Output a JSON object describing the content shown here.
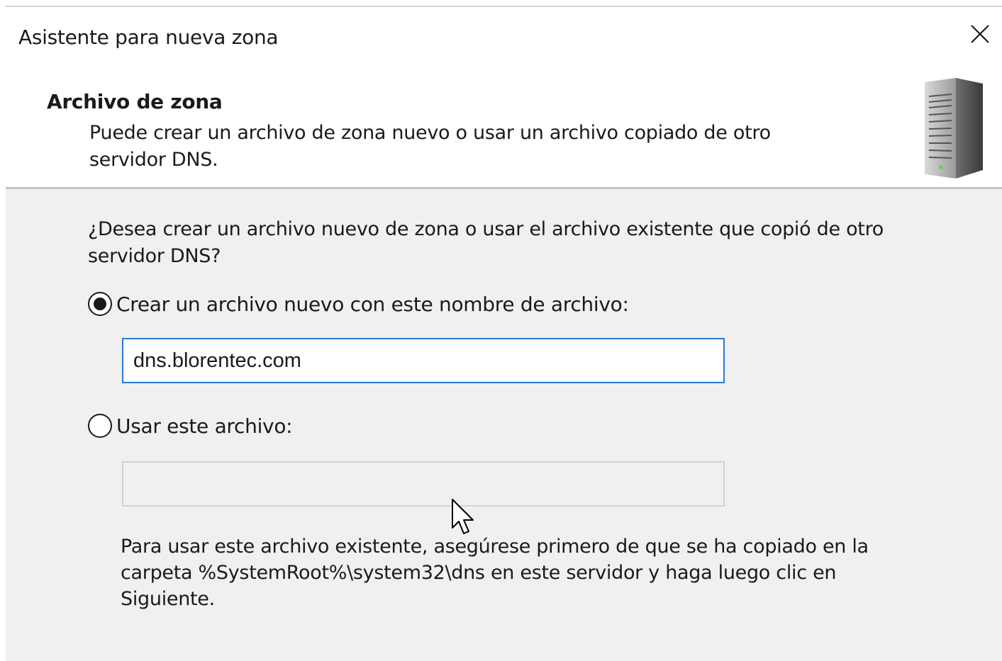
{
  "window": {
    "title": "Asistente para nueva zona",
    "close_icon": "close-icon"
  },
  "header": {
    "title": "Archivo de zona",
    "description": "Puede crear un archivo de zona nuevo o usar un archivo copiado de otro servidor DNS.",
    "icon": "server-icon"
  },
  "content": {
    "question": "¿Desea crear un archivo nuevo de zona o usar el archivo existente que copió de otro servidor DNS?",
    "option_new": {
      "label": "Crear un archivo nuevo con este nombre de archivo:",
      "selected": true,
      "value": "dns.blorentec.com"
    },
    "option_existing": {
      "label": "Usar este archivo:",
      "selected": false,
      "value": ""
    },
    "note": "Para usar este archivo existente, asegúrese primero de que se ha copiado en la carpeta %SystemRoot%\\system32\\dns en este servidor y haga luego clic en Siguiente."
  },
  "colors": {
    "accent": "#2b7ad6",
    "content_background": "#f0f0f0",
    "header_background": "#ffffff"
  }
}
